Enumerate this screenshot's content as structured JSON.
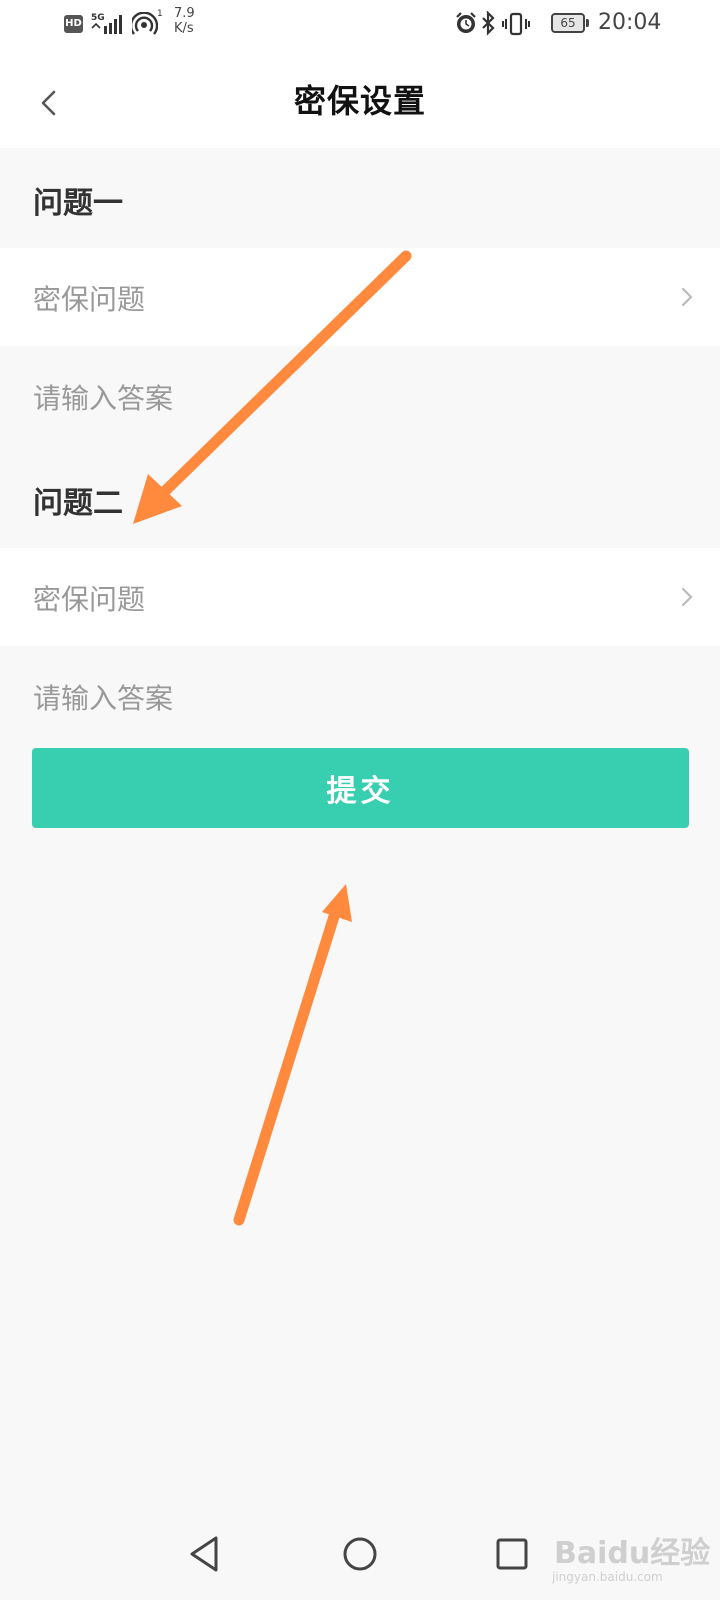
{
  "status_bar": {
    "hd_badge": "HD",
    "network_type": "5G",
    "hotspot_count": "1",
    "speed_value": "7.9",
    "speed_unit": "K/s",
    "battery_level": "65",
    "time": "20:04",
    "icons": [
      "hd-icon",
      "signal-icon",
      "hotspot-icon",
      "alarm-icon",
      "bluetooth-icon",
      "vibrate-icon",
      "battery-icon"
    ]
  },
  "header": {
    "title": "密保设置",
    "back_icon": "chevron-left-icon"
  },
  "form": {
    "question1": {
      "section_title": "问题一",
      "select_label": "密保问题",
      "answer_placeholder": "请输入答案",
      "answer_value": ""
    },
    "question2": {
      "section_title": "问题二",
      "select_label": "密保问题",
      "answer_placeholder": "请输入答案",
      "answer_value": ""
    },
    "submit_label": "提交"
  },
  "annotations": {
    "arrow_color": "#ff8a3d"
  },
  "nav_bar": {
    "icons": [
      "back-triangle-icon",
      "home-circle-icon",
      "recents-square-icon"
    ]
  },
  "watermark": {
    "logo": "Baidu经验",
    "url": "jingyan.baidu.com"
  },
  "colors": {
    "accent": "#38cfb0",
    "background": "#f8f8f8",
    "placeholder": "#999999"
  }
}
